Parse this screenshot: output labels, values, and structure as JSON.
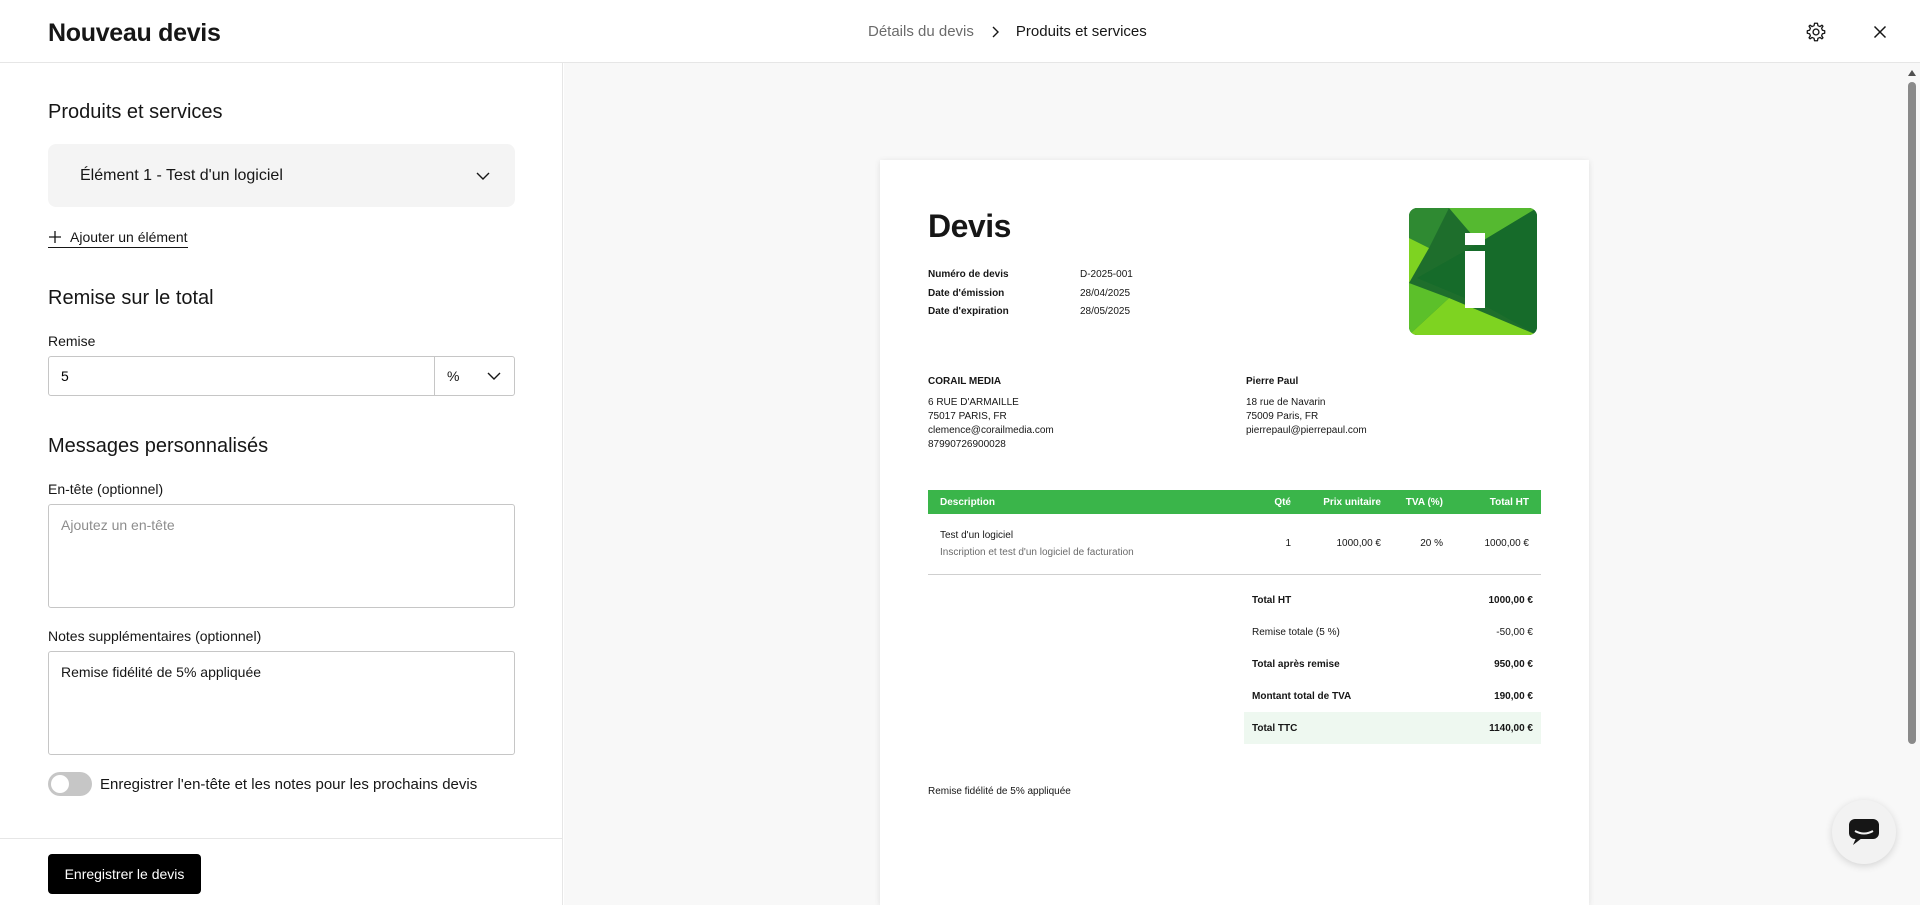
{
  "header": {
    "title": "Nouveau devis",
    "breadcrumb_prev": "Détails du devis",
    "breadcrumb_current": "Produits et services"
  },
  "form": {
    "products_title": "Produits et services",
    "item_accordion_label": "Élément 1 - Test d'un logiciel",
    "add_item_label": "Ajouter un élément",
    "discount_title": "Remise sur le total",
    "discount_label": "Remise",
    "discount_value": "5",
    "discount_unit": "%",
    "messages_title": "Messages personnalisés",
    "header_label": "En-tête (optionnel)",
    "header_placeholder": "Ajoutez un en-tête",
    "notes_label": "Notes supplémentaires (optionnel)",
    "notes_value": "Remise fidélité de 5% appliquée",
    "toggle_label": "Enregistrer l'en-tête et les notes pour les prochains devis",
    "toggle_on": false,
    "save_button": "Enregistrer le devis"
  },
  "preview": {
    "doc_title": "Devis",
    "meta": [
      {
        "label": "Numéro de devis",
        "value": "D-2025-001"
      },
      {
        "label": "Date d'émission",
        "value": "28/04/2025"
      },
      {
        "label": "Date d'expiration",
        "value": "28/05/2025"
      }
    ],
    "seller": {
      "name": "CORAIL MEDIA",
      "lines": [
        "6 RUE D'ARMAILLE",
        "75017 PARIS, FR",
        "clemence@corailmedia.com",
        "87990726900028"
      ]
    },
    "client": {
      "name": "Pierre Paul",
      "lines": [
        "18 rue de Navarin",
        "75009 Paris, FR",
        "pierrepaul@pierrepaul.com"
      ]
    },
    "table_headers": [
      "Description",
      "Qté",
      "Prix unitaire",
      "TVA (%)",
      "Total HT"
    ],
    "items": [
      {
        "name": "Test d'un logiciel",
        "desc": "Inscription et test d'un logiciel de facturation",
        "qty": "1",
        "unit_price": "1000,00 €",
        "vat": "20 %",
        "total": "1000,00 €"
      }
    ],
    "totals": [
      {
        "label": "Total HT",
        "value": "1000,00 €",
        "style": "bold"
      },
      {
        "label": "Remise totale (5 %)",
        "value": "-50,00 €",
        "style": "normal"
      },
      {
        "label": "Total après remise",
        "value": "950,00 €",
        "style": "bold"
      },
      {
        "label": "Montant total de TVA",
        "value": "190,00 €",
        "style": "bold"
      },
      {
        "label": "Total TTC",
        "value": "1140,00 €",
        "style": "grand"
      }
    ],
    "notes": "Remise fidélité de 5% appliquée",
    "accent_color": "#3ab54a"
  },
  "icons": {
    "settings": "gear-icon",
    "close": "close-icon",
    "chat": "chat-icon"
  }
}
